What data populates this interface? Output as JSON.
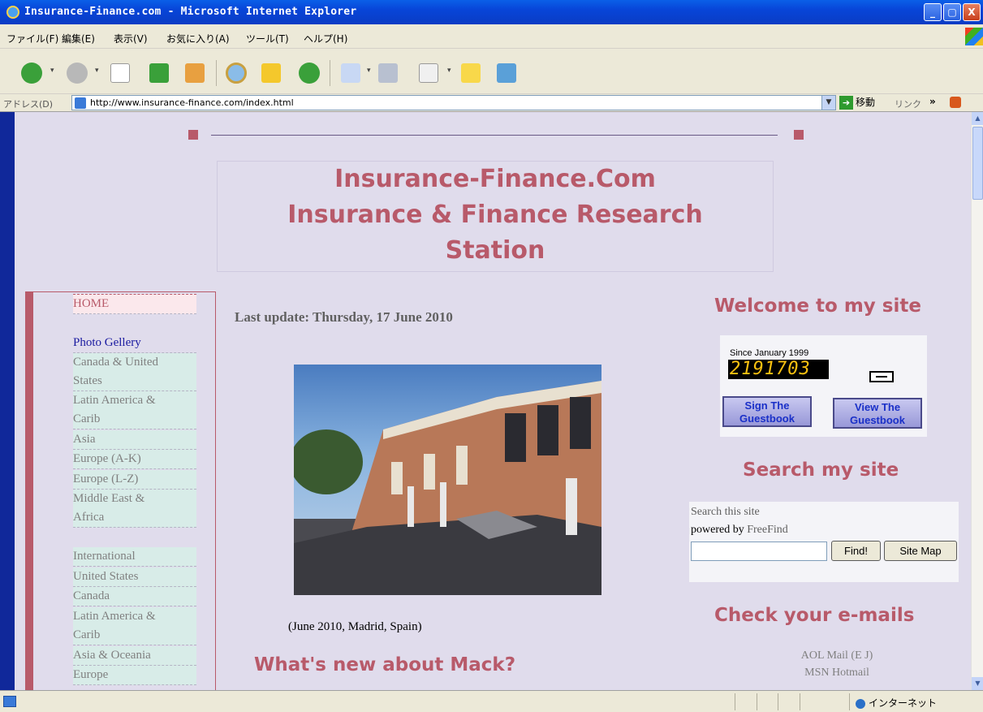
{
  "window": {
    "title": "Insurance-Finance.com - Microsoft Internet Explorer",
    "min": "_",
    "max": "▢",
    "close": "X"
  },
  "menu": {
    "file": "ファイル(F)",
    "edit": "編集(E)",
    "view": "表示(V)",
    "favorites": "お気に入り(A)",
    "tools": "ツール(T)",
    "help": "ヘルプ(H)"
  },
  "address": {
    "label": "アドレス(D)",
    "url": "http://www.insurance-finance.com/index.html",
    "go": "移動",
    "links": "リンク",
    "more": "»"
  },
  "header": {
    "title_line1": "Insurance-Finance.Com",
    "title_line2": "Insurance & Finance Research",
    "title_line3": "Station"
  },
  "nav": {
    "home": "HOME",
    "photo": "Photo Gellery",
    "g1": [
      "Canada & United",
      "States",
      "Latin America &",
      "Carib",
      "Asia",
      "Europe (A-K)",
      "Europe (L-Z)",
      "Middle East &",
      "Africa"
    ],
    "g2": [
      "International",
      "United States",
      "Canada",
      "Latin America &",
      "Carib",
      "Asia & Oceania",
      "Europe"
    ]
  },
  "main": {
    "last_update": "Last update: Thursday, 17 June 2010",
    "caption": "(June 2010, Madrid, Spain)",
    "whats_new": "What's new about Mack?"
  },
  "right": {
    "welcome": "Welcome to my site",
    "since": "Since January 1999",
    "counter": "2191703",
    "sign": "Sign The Guestbook",
    "view": "View The Guestbook",
    "search_head": "Search my site",
    "search_label": "Search this site",
    "powered": "powered by ",
    "freefind": "FreeFind",
    "find_btn": "Find!",
    "sitemap_btn": "Site Map",
    "check": "Check your e-mails",
    "mail1": "AOL Mail (E J)",
    "mail2": "MSN Hotmail"
  },
  "status": {
    "text": "",
    "zone": "インターネット"
  },
  "colors": {
    "accent": "#b85a6a",
    "page_bg": "#e0dcec",
    "nav_bg": "#d8ece8"
  }
}
